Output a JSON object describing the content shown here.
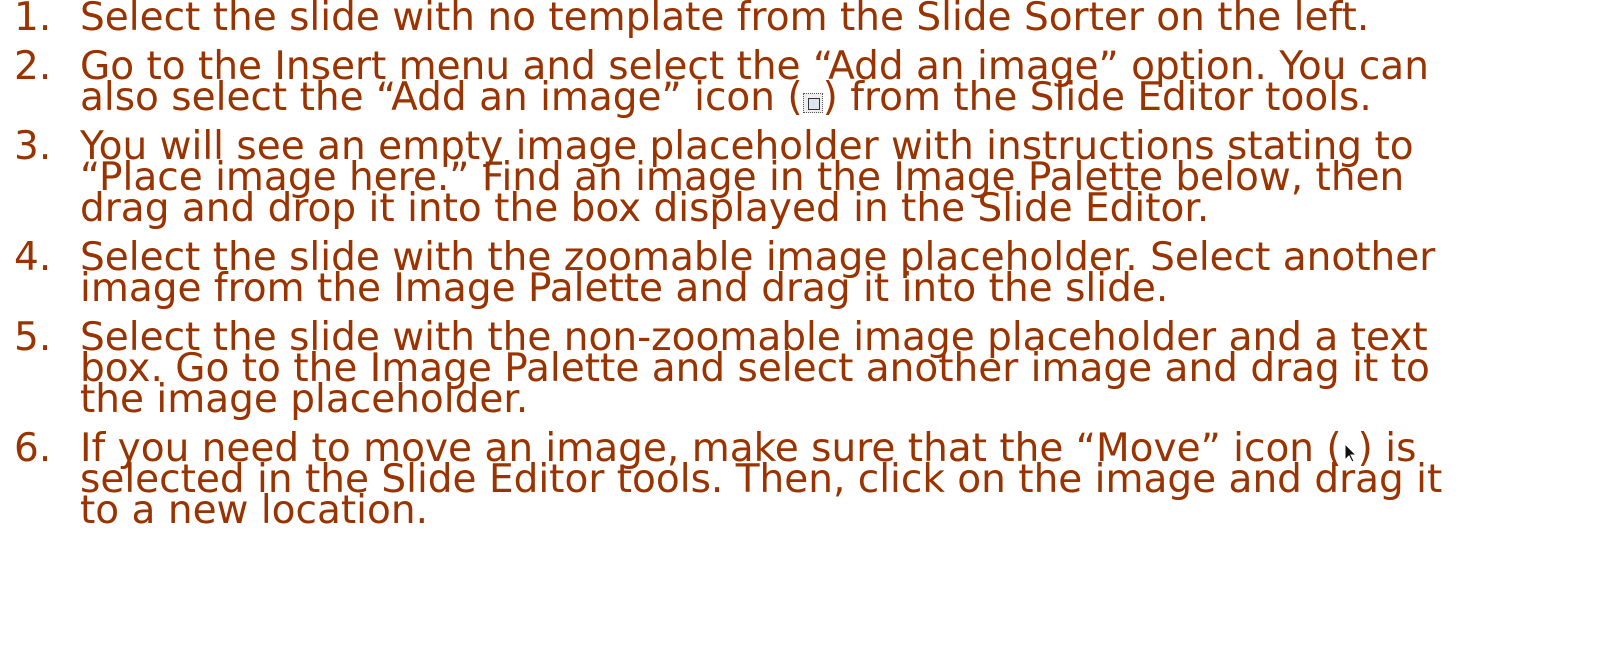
{
  "items": [
    {
      "number": "1.",
      "text": "Select the slide with no template from the Slide Sorter on the left."
    },
    {
      "number": "2.",
      "text_before_icon": "Go to the Insert menu and select the “Add an image” option. You can\nalso select the “Add an image” icon (",
      "icon": "add-image-icon",
      "text_after_icon": ") from the Slide Editor tools."
    },
    {
      "number": "3.",
      "text": "You will see an empty image placeholder with instructions stating to\n“Place image here.” Find an image in the Image Palette below, then\ndrag and drop it into the box displayed in the Slide Editor."
    },
    {
      "number": "4.",
      "text": "Select the slide with the zoomable image placeholder.  Select another\nimage from the Image Palette and drag it into the slide."
    },
    {
      "number": "5.",
      "text": "Select the slide with the non-zoomable image placeholder and a text\nbox.  Go to the Image Palette and select another image and drag it to\nthe image placeholder."
    },
    {
      "number": "6.",
      "text_before_icon": "If you need to move an image, make sure that the “Move” icon (",
      "icon": "move-cursor-icon",
      "text_after_icon": ") is\nselected in the Slide Editor tools. Then, click on the image and drag it\nto a new location."
    }
  ],
  "colors": {
    "text": "#993300",
    "background": "#ffffff"
  }
}
